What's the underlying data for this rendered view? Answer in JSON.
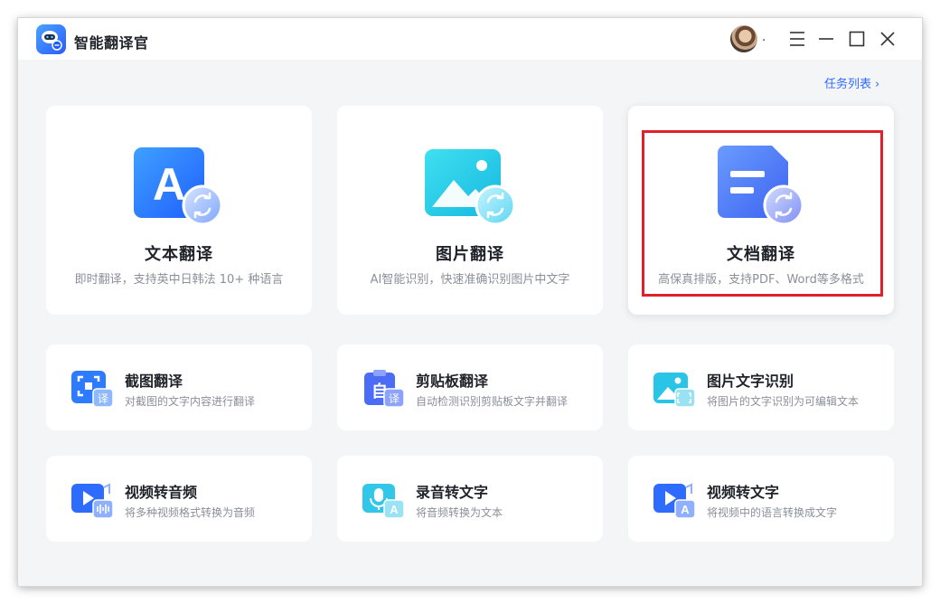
{
  "app": {
    "title": "智能翻译官",
    "avatar_suffix": "."
  },
  "header": {
    "task_list_label": "任务列表",
    "task_list_chevron": "›"
  },
  "main_features": [
    {
      "title": "文本翻译",
      "subtitle": "即时翻译，支持英中日韩法 10+ 种语言",
      "icon": "text-translate-icon"
    },
    {
      "title": "图片翻译",
      "subtitle": "AI智能识别，快速准确识别图片中文字",
      "icon": "image-translate-icon"
    },
    {
      "title": "文档翻译",
      "subtitle": "高保真排版，支持PDF、Word等多格式",
      "icon": "document-translate-icon",
      "selected": true
    }
  ],
  "tools": [
    {
      "title": "截图翻译",
      "subtitle": "对截图的文字内容进行翻译",
      "icon": "screenshot-translate-icon",
      "badge": "译"
    },
    {
      "title": "剪贴板翻译",
      "subtitle": "自动检测识别剪贴板文字并翻译",
      "icon": "clipboard-translate-icon",
      "badge": "译"
    },
    {
      "title": "图片文字识别",
      "subtitle": "将图片的文字识别为可编辑文本",
      "icon": "image-ocr-icon"
    },
    {
      "title": "视频转音频",
      "subtitle": "将多种视频格式转换为音频",
      "icon": "video-to-audio-icon"
    },
    {
      "title": "录音转文字",
      "subtitle": "将音频转换为文本",
      "icon": "audio-to-text-icon",
      "badge": "A"
    },
    {
      "title": "视频转文字",
      "subtitle": "将视频中的语言转换成文字",
      "icon": "video-to-text-icon",
      "badge": "A"
    }
  ],
  "colors": {
    "accent": "#2f6bff",
    "highlight": "#e0202a",
    "background": "#f4f5f7"
  }
}
